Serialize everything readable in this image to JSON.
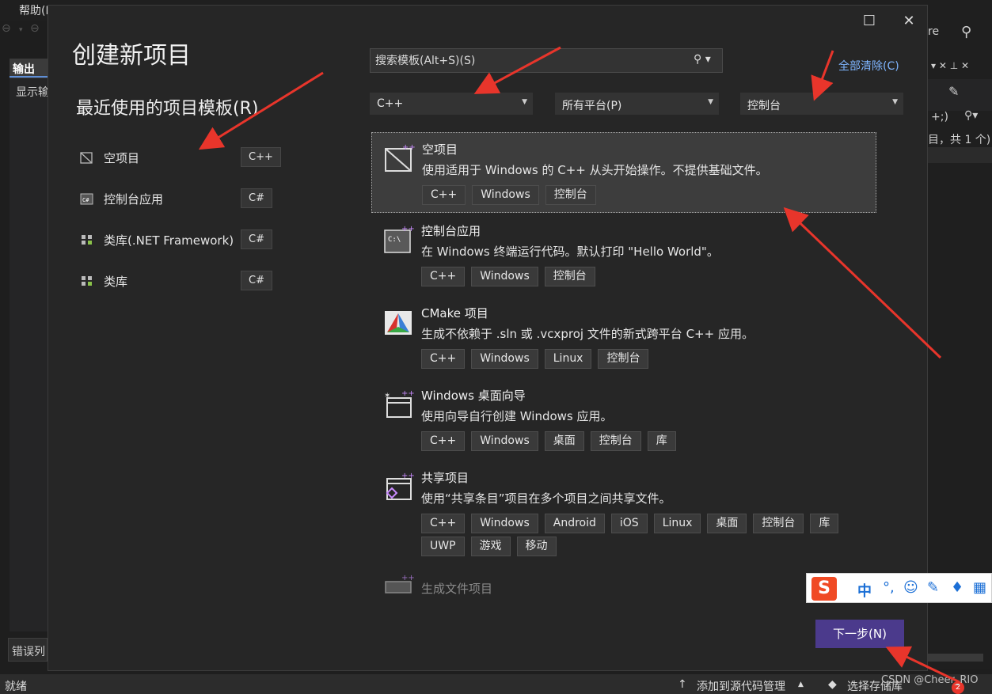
{
  "background": {
    "menu_help": "帮助(H)",
    "output_tab": "输出",
    "output_show": "显示输",
    "error_tab": "错误列",
    "right_top_text": "re",
    "right_row1": "+;)",
    "right_row2": "目，共 1 个)",
    "status": {
      "ready": "就绪",
      "add_source": "添加到源代码管理",
      "select_repo": "选择存储库",
      "badge": "2"
    },
    "watermark": "CSDN @Cheer_RIO"
  },
  "dialog": {
    "title": "创建新项目",
    "recent_title": "最近使用的项目模板(R)",
    "recent_items": [
      {
        "label": "空项目",
        "lang": "C++"
      },
      {
        "label": "控制台应用",
        "lang": "C#"
      },
      {
        "label": "类库(.NET Framework)",
        "lang": "C#"
      },
      {
        "label": "类库",
        "lang": "C#"
      }
    ],
    "search": {
      "placeholder": "搜索模板(Alt+S)(S)"
    },
    "clear_all": "全部清除(C)",
    "filters": {
      "language": "C++",
      "platform": "所有平台(P)",
      "project_type": "控制台"
    },
    "templates": [
      {
        "name": "空项目",
        "desc": "使用适用于 Windows 的 C++ 从头开始操作。不提供基础文件。",
        "tags": [
          "C++",
          "Windows",
          "控制台"
        ]
      },
      {
        "name": "控制台应用",
        "desc": "在 Windows 终端运行代码。默认打印 \"Hello World\"。",
        "tags": [
          "C++",
          "Windows",
          "控制台"
        ]
      },
      {
        "name": "CMake 项目",
        "desc": "生成不依赖于 .sln 或 .vcxproj 文件的新式跨平台 C++ 应用。",
        "tags": [
          "C++",
          "Windows",
          "Linux",
          "控制台"
        ]
      },
      {
        "name": "Windows 桌面向导",
        "desc": "使用向导自行创建 Windows 应用。",
        "tags": [
          "C++",
          "Windows",
          "桌面",
          "控制台",
          "库"
        ]
      },
      {
        "name": "共享项目",
        "desc": "使用“共享条目”项目在多个项目之间共享文件。",
        "tags": [
          "C++",
          "Windows",
          "Android",
          "iOS",
          "Linux",
          "桌面",
          "控制台",
          "库",
          "UWP",
          "游戏",
          "移动"
        ]
      },
      {
        "name": "生成文件项目",
        "desc": "",
        "tags": []
      }
    ],
    "next_button": "下一步(N)"
  },
  "ime": {
    "logo": "S",
    "mode": "中"
  },
  "colors": {
    "accent_button": "#4b3a8c",
    "link": "#7fb5ff",
    "annotation": "#e8352b"
  }
}
